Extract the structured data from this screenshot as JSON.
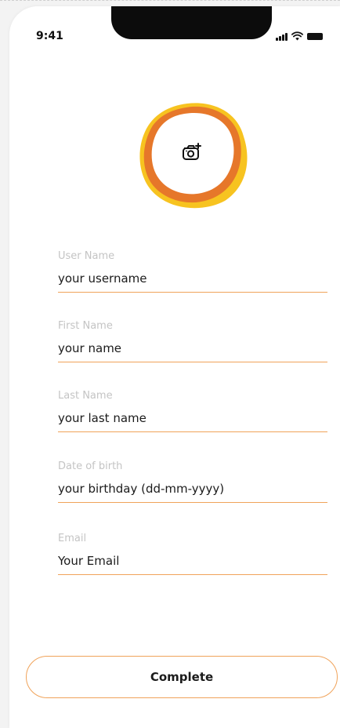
{
  "status_bar": {
    "time": "9:41"
  },
  "avatar": {
    "icon": "camera-plus-icon",
    "colors": {
      "outer_ring": "#f7c320",
      "inner_ring": "#e6772a"
    }
  },
  "form": {
    "fields": [
      {
        "label": "User Name",
        "value": "your username"
      },
      {
        "label": "First Name",
        "value": "your name"
      },
      {
        "label": "Last Name",
        "value": "your last name"
      },
      {
        "label": "Date of birth",
        "value": "your birthday (dd-mm-yyyy)"
      },
      {
        "label": "Email",
        "value": "Your Email"
      }
    ],
    "accent_color": "#f0a35a"
  },
  "actions": {
    "complete_label": "Complete"
  }
}
